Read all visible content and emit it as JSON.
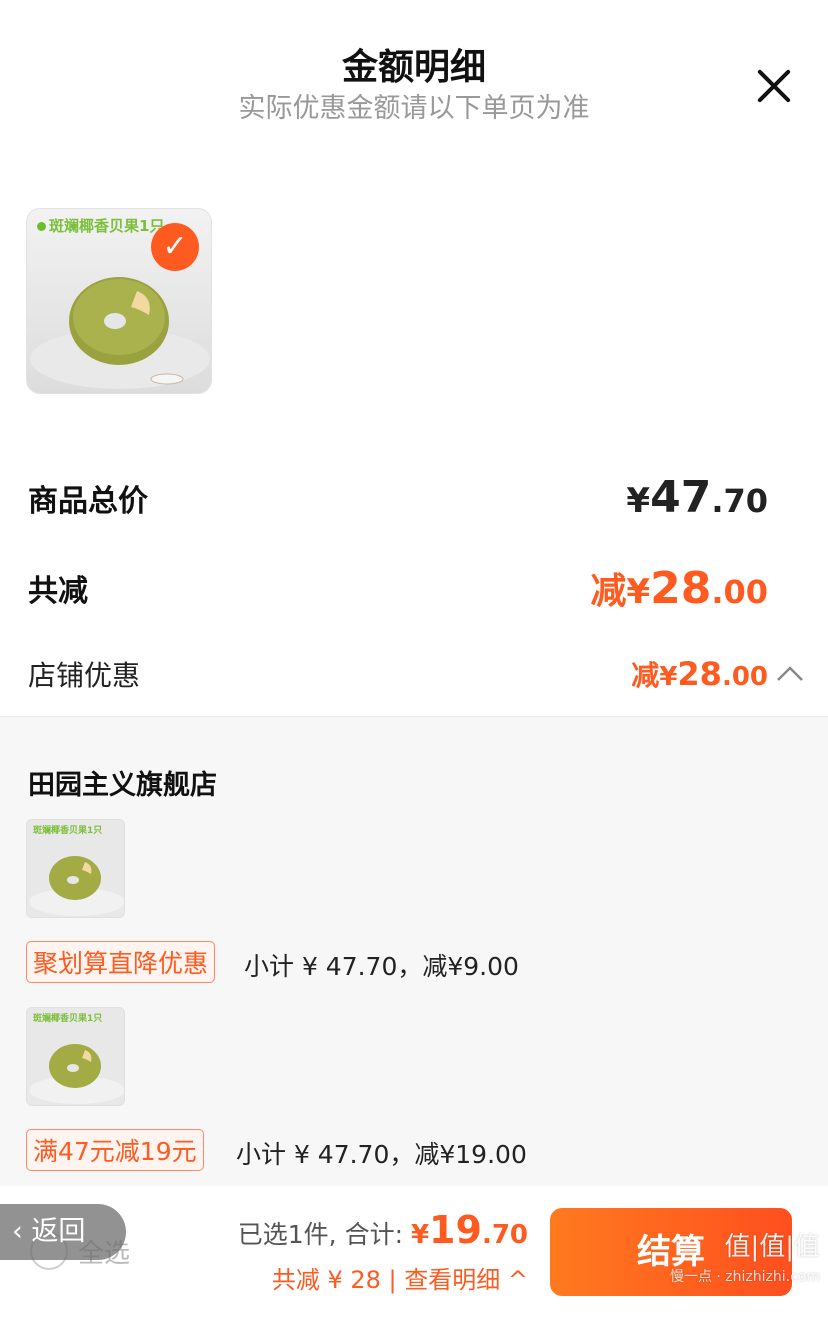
{
  "header": {
    "title": "金额明细",
    "subtitle": "实际优惠金额请以下单页为准",
    "close_icon": "close-icon"
  },
  "product": {
    "image_label": "斑斓椰香贝果1只",
    "selected": true
  },
  "summary": {
    "total_label": "商品总价",
    "total_currency": "¥",
    "total_int": "47",
    "total_dec": ".70",
    "discount_label": "共减",
    "discount_prefix": "减",
    "discount_currency": "¥",
    "discount_int": "28",
    "discount_dec": ".00",
    "store_discount_label": "店铺优惠",
    "store_discount_prefix": "减",
    "store_discount_currency": "¥",
    "store_discount_int": "28",
    "store_discount_dec": ".00"
  },
  "store": {
    "name": "田园主义旗舰店",
    "items": [
      {
        "image_label": "斑斓椰香贝果1只",
        "tag": "聚划算直降优惠",
        "subtotal": "小计 ¥ 47.70，减¥9.00"
      },
      {
        "image_label": "斑斓椰香贝果1只",
        "tag": "满47元减19元",
        "subtotal": "小计 ¥ 47.70，减¥19.00"
      }
    ]
  },
  "bottom": {
    "back_label": "返回",
    "select_all_label": "全选",
    "selected_text": "已选1件, 合计:",
    "sum_currency": "¥",
    "sum_int": "19",
    "sum_dec": ".70",
    "detail_text": "共减 ¥ 28 | 查看明细",
    "checkout_label": "结算"
  },
  "watermark": {
    "text": "值|值|值",
    "sub": "慢一点 · zhizhizhi.com"
  },
  "colors": {
    "accent": "#ff5a1f",
    "text": "#222222",
    "muted": "#999999"
  }
}
